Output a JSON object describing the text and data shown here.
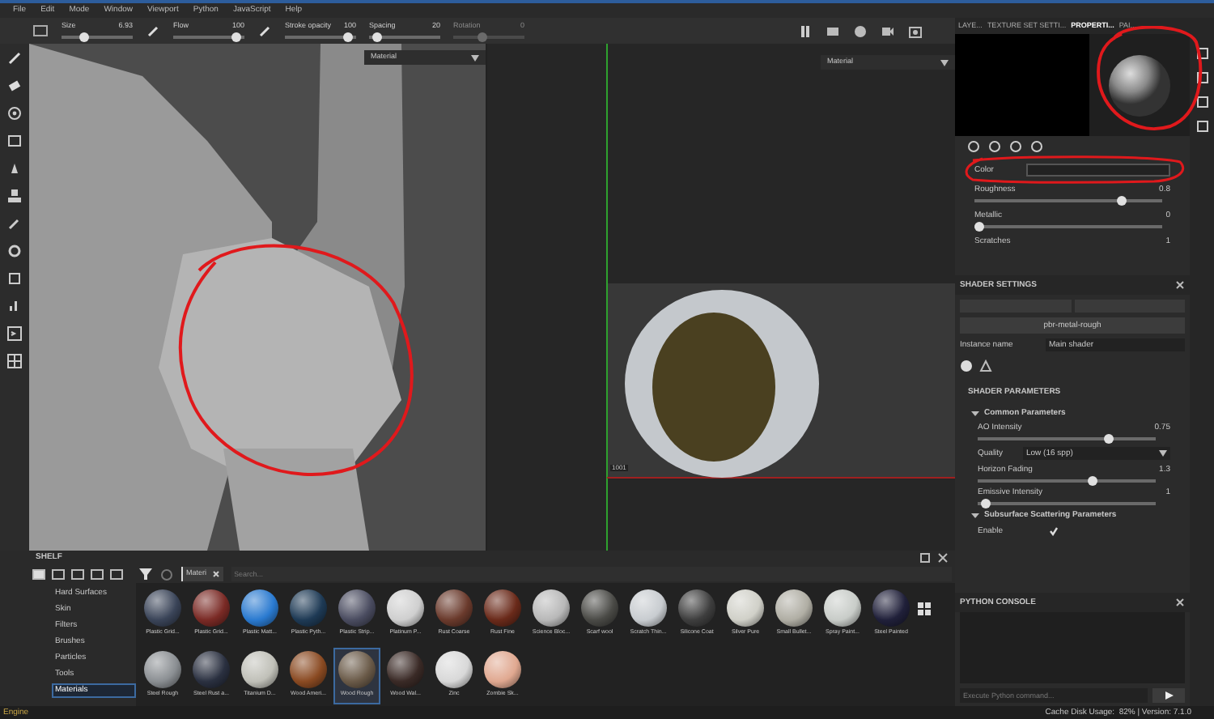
{
  "menu": [
    "File",
    "Edit",
    "Mode",
    "Window",
    "Viewport",
    "Python",
    "JavaScript",
    "Help"
  ],
  "toolbar": {
    "sliders": [
      {
        "label": "Size",
        "reading": "6.93",
        "level": 0.3,
        "disabled": false
      },
      {
        "label": "Flow",
        "reading": "100",
        "level": 0.95,
        "disabled": false
      },
      {
        "label": "Stroke opacity",
        "reading": "100",
        "level": 0.95,
        "disabled": false
      },
      {
        "label": "Spacing",
        "reading": "20",
        "level": 0.05,
        "disabled": false
      },
      {
        "label": "Rotation",
        "reading": "0",
        "level": 0.4,
        "disabled": true
      }
    ]
  },
  "viewports": [
    {
      "dropdown": "Material"
    },
    {
      "dropdown": "Material",
      "udim": "1001"
    }
  ],
  "panel_tabs": [
    {
      "label": "LAYE...",
      "selected": false
    },
    {
      "label": "TEXTURE SET SETTI...",
      "selected": false
    },
    {
      "label": "PROPERTI...",
      "selected": true
    },
    {
      "label": "PAI...",
      "selected": false
    }
  ],
  "properties": {
    "color_label": "Color",
    "params": [
      {
        "label": "Roughness",
        "reading": "0.8",
        "level": 0.8
      },
      {
        "label": "Metallic",
        "reading": "0",
        "level": 0
      },
      {
        "label": "Scratches",
        "reading": "1"
      }
    ]
  },
  "shader_settings": {
    "title": "SHADER SETTINGS",
    "shader": "pbr-metal-rough",
    "instance_label": "Instance name",
    "instance_value": "Main shader"
  },
  "shader_parameters": {
    "title": "SHADER PARAMETERS",
    "groups": [
      {
        "title": "Common Parameters",
        "expanded": true,
        "params": [
          {
            "kind": "slider",
            "label": "AO Intensity",
            "reading": "0.75",
            "level": 0.75
          },
          {
            "kind": "dropdown",
            "label": "Quality",
            "value": "Low (16 spp)"
          },
          {
            "kind": "slider",
            "label": "Horizon Fading",
            "reading": "1.3",
            "level": 0.65
          },
          {
            "kind": "slider",
            "label": "Emissive Intensity",
            "reading": "1",
            "level": 0.02
          }
        ]
      },
      {
        "title": "Subsurface Scattering Parameters",
        "expanded": true,
        "params": [
          {
            "kind": "checkbox",
            "label": "Enable",
            "checked": true
          }
        ]
      }
    ]
  },
  "python_console": {
    "title": "PYTHON CONSOLE",
    "placeholder": "Execute Python command..."
  },
  "shelf": {
    "title": "SHELF",
    "filter_chip": "Materi",
    "search_placeholder": "Search...",
    "categories": [
      {
        "label": "Hard Surfaces",
        "selected": false
      },
      {
        "label": "Skin",
        "selected": false
      },
      {
        "label": "Filters",
        "selected": false
      },
      {
        "label": "Brushes",
        "selected": false
      },
      {
        "label": "Particles",
        "selected": false
      },
      {
        "label": "Tools",
        "selected": false
      },
      {
        "label": "Materials",
        "selected": true
      }
    ],
    "materials": [
      {
        "label": "Plastic Grid...",
        "color": "#3a4458",
        "selected": false
      },
      {
        "label": "Plastic Grid...",
        "color": "#7a2a25",
        "selected": false
      },
      {
        "label": "Plastic Matt...",
        "color": "#2a7ad0",
        "selected": false
      },
      {
        "label": "Plastic Pyth...",
        "color": "#1e3a55",
        "selected": false
      },
      {
        "label": "Plastic Strip...",
        "color": "#4a4c60",
        "selected": false
      },
      {
        "label": "Platinum P...",
        "color": "#cfcfcf",
        "selected": false
      },
      {
        "label": "Rust Coarse",
        "color": "#6a3a2c",
        "selected": false
      },
      {
        "label": "Rust Fine",
        "color": "#6a2a1a",
        "selected": false
      },
      {
        "label": "Science Bloc...",
        "color": "#b8b8b8",
        "selected": false
      },
      {
        "label": "Scarf wool",
        "color": "#4a4a46",
        "selected": false
      },
      {
        "label": "Scratch Thin...",
        "color": "#c8ccd0",
        "selected": false
      },
      {
        "label": "Silicone Coat",
        "color": "#3e3e3e",
        "selected": false
      },
      {
        "label": "Silver Pure",
        "color": "#d0d0c8",
        "selected": false
      },
      {
        "label": "Small Bullet...",
        "color": "#b0aea4",
        "selected": false
      },
      {
        "label": "Spray Paint...",
        "color": "#c8ccc8",
        "selected": false
      },
      {
        "label": "Steel Painted",
        "color": "#20203a",
        "selected": false
      },
      {
        "label": "Steel Rough",
        "color": "#8a8e92",
        "selected": false
      },
      {
        "label": "Steel Rust a...",
        "color": "#2a3040",
        "selected": false
      },
      {
        "label": "Titanium D...",
        "color": "#c0c0b8",
        "selected": false
      },
      {
        "label": "Wood Ameri...",
        "color": "#8a4a22",
        "selected": false
      },
      {
        "label": "Wood Rough",
        "color": "#6a5a48",
        "selected": true
      },
      {
        "label": "Wood Wal...",
        "color": "#3a2a26",
        "selected": false
      },
      {
        "label": "Zinc",
        "color": "#d8d8d8",
        "selected": false
      },
      {
        "label": "Zombie Sk...",
        "color": "#e0a890",
        "selected": false
      }
    ]
  },
  "status_bar": {
    "left": "Engine",
    "right": "Cache Disk Usage:  82% | Version: 7.1.0"
  }
}
